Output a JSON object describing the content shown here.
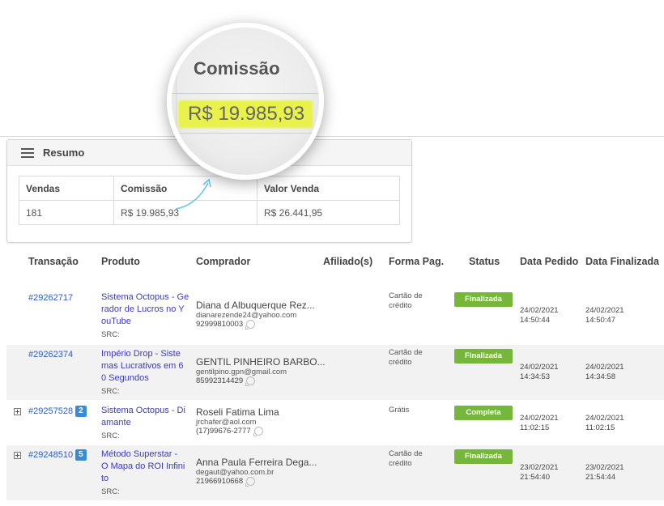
{
  "magnifier": {
    "label": "Comissão",
    "value": "R$ 19.985,93"
  },
  "resumo": {
    "title": "Resumo",
    "headers": [
      "Vendas",
      "Comissão",
      "Valor Venda"
    ],
    "values": [
      "181",
      "R$ 19.985,93",
      "R$ 26.441,95"
    ]
  },
  "table": {
    "headers": {
      "transacao": "Transação",
      "produto": "Produto",
      "comprador": "Comprador",
      "afiliado": "Afiliado(s)",
      "forma_pag": "Forma Pag.",
      "status": "Status",
      "data_pedido": "Data Pedido",
      "data_finalizada": "Data Finalizada"
    },
    "rows": [
      {
        "id": "#29262717",
        "badge": "",
        "produto_lines": [
          "Sistema Octopus - Ge",
          "rador de Lucros no Y",
          "ouTube"
        ],
        "src": "SRC:",
        "buyer_name": "Diana d Albuquerque Rez...",
        "buyer_email": "dianarezende24@yahoo.com",
        "buyer_phone": "92999810003",
        "pay_lines": [
          "Cartão de",
          "crédito"
        ],
        "status": "Finalizada",
        "pedido_date": "24/02/2021",
        "pedido_time": "14:50:44",
        "final_date": "24/02/2021",
        "final_time": "14:50:47"
      },
      {
        "id": "#29262374",
        "badge": "",
        "produto_lines": [
          "Império Drop - Siste",
          "mas Lucrativos em 6",
          "0 Segundos"
        ],
        "src": "SRC:",
        "buyer_name": "GENTIL PINHEIRO BARBO...",
        "buyer_email": "gentilpino.gpn@gmail.com",
        "buyer_phone": "85992314429",
        "pay_lines": [
          "Cartão de",
          "crédito"
        ],
        "status": "Finalizada",
        "pedido_date": "24/02/2021",
        "pedido_time": "14:34:53",
        "final_date": "24/02/2021",
        "final_time": "14:34:58"
      },
      {
        "id": "#29257528",
        "badge": "2",
        "produto_lines": [
          "Sistema Octopus - Di",
          "amante"
        ],
        "src": "SRC:",
        "buyer_name": "Roseli Fatima Lima",
        "buyer_email": "jrchafer@aol.com",
        "buyer_phone": "(17)99676-2777",
        "pay_lines": [
          "Grátis"
        ],
        "status": "Completa",
        "pedido_date": "24/02/2021",
        "pedido_time": "11:02:15",
        "final_date": "24/02/2021",
        "final_time": "11:02:15"
      },
      {
        "id": "#29248510",
        "badge": "5",
        "produto_lines": [
          "Método Superstar -",
          "O Mapa do ROI Infini",
          "to"
        ],
        "src": "SRC:",
        "buyer_name": "Anna Paula Ferreira Dega...",
        "buyer_email": "degaut@yahoo.com.br",
        "buyer_phone": "21966910668",
        "pay_lines": [
          "Cartão de",
          "crédito"
        ],
        "status": "Finalizada",
        "pedido_date": "23/02/2021",
        "pedido_time": "21:54:40",
        "final_date": "23/02/2021",
        "final_time": "21:54:44"
      }
    ]
  },
  "colors": {
    "status_green": "#76b73b",
    "link_blue": "#2e5fb8",
    "product_blue": "#3b3bb5",
    "badge_blue": "#3b8bd4",
    "highlight_yellow": "#e8f24a"
  }
}
